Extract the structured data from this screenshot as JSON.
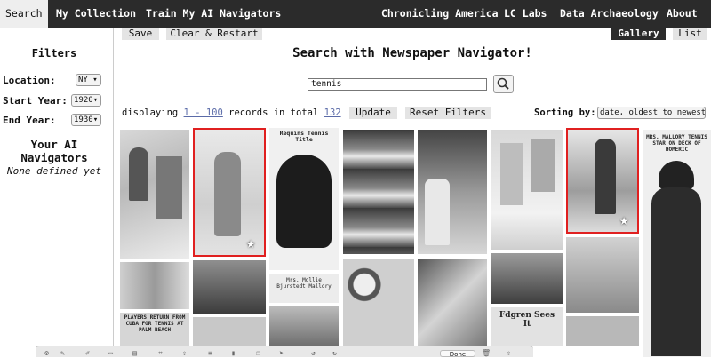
{
  "nav": {
    "search": "Search",
    "my_collection": "My Collection",
    "train": "Train My AI Navigators",
    "chronicling": "Chronicling America",
    "lc_labs": "LC Labs",
    "data_archaeology": "Data Archaeology",
    "about": "About"
  },
  "sidebar": {
    "filters_title": "Filters",
    "location_label": "Location:",
    "location_value": "NY",
    "start_year_label": "Start Year:",
    "start_year_value": "1920",
    "end_year_label": "End Year:",
    "end_year_value": "1930",
    "navigators_title": "Your AI Navigators",
    "navigators_empty": "None defined yet"
  },
  "toolbar": {
    "save": "Save",
    "clear_restart": "Clear & Restart",
    "gallery": "Gallery",
    "list": "List"
  },
  "heading": "Search with Newspaper Navigator!",
  "search": {
    "value": "tennis"
  },
  "records": {
    "prefix": "displaying",
    "range": "1 - 100",
    "middle": "records in total",
    "total": "132",
    "update": "Update",
    "reset": "Reset Filters"
  },
  "sorting": {
    "label": "Sorting by:",
    "value": "date, oldest to newest"
  },
  "gallery": {
    "captions": {
      "tile2": "Mrs. Mollie Bjurstedt Mallory",
      "tile3": "Requins Tennis Title",
      "tile9": "MRS. MALLORY TENNIS STAR ON DECK OF HOMERIC",
      "tile12": "Fdgren Sees It",
      "tile13": "PLAYERS RETURN FROM CUBA FOR TENNIS AT PALM BEACH"
    },
    "selected_marker": "★"
  },
  "dock": {
    "done": "Done"
  }
}
